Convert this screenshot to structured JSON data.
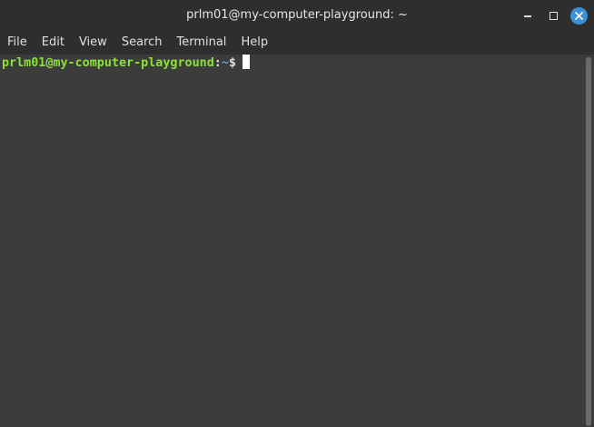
{
  "window": {
    "title": "prlm01@my-computer-playground: ~",
    "controls": {
      "minimize_icon": "minimize-icon",
      "maximize_icon": "maximize-icon",
      "close_icon": "close-icon",
      "close_color": "#3d8fd6"
    }
  },
  "menu": {
    "items": [
      {
        "label": "File"
      },
      {
        "label": "Edit"
      },
      {
        "label": "View"
      },
      {
        "label": "Search"
      },
      {
        "label": "Terminal"
      },
      {
        "label": "Help"
      }
    ]
  },
  "terminal": {
    "prompt": {
      "user_host": "prlm01@my-computer-playground",
      "separator": ":",
      "path": "~",
      "symbol": "$"
    },
    "colors": {
      "background": "#3c3c3c",
      "user_host": "#8ae234",
      "path": "#729fcf"
    }
  }
}
